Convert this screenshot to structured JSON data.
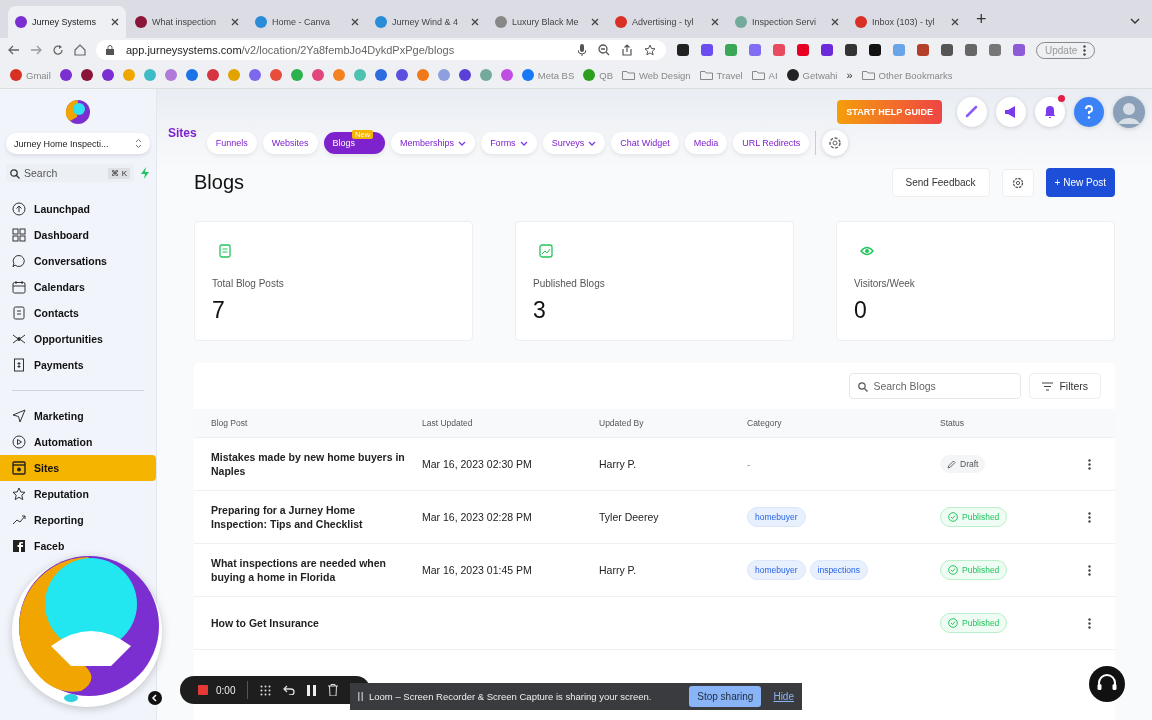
{
  "browser": {
    "tabs": [
      {
        "title": "Jurney Systems",
        "selected": true,
        "color": "#7b2fd0"
      },
      {
        "title": "What inspection",
        "selected": false,
        "color": "#8a1538"
      },
      {
        "title": "Home - Canva",
        "selected": false,
        "color": "#2a8bd8"
      },
      {
        "title": "Jurney Wind & 4",
        "selected": false,
        "color": "#2a8bd8"
      },
      {
        "title": "Luxury Black Me",
        "selected": false,
        "color": "#888888"
      },
      {
        "title": "Advertising - tyl",
        "selected": false,
        "color": "#d93025"
      },
      {
        "title": "Inspection Servi",
        "selected": false,
        "color": "#74aa9c"
      },
      {
        "title": "Inbox (103) - tyl",
        "selected": false,
        "color": "#d93025"
      }
    ],
    "new_tab": "+",
    "url": {
      "domain": "app.jurneysystems.com",
      "path": "/v2/location/2Ya8fembJo4DykdPxPge/blogs"
    },
    "extensions": [
      {
        "color": "#222222"
      },
      {
        "color": "#6a4cf0"
      },
      {
        "color": "#3aa757"
      },
      {
        "color": "#7f6df2"
      },
      {
        "color": "#e84a5f"
      },
      {
        "color": "#e60023"
      },
      {
        "color": "#6c2bd9"
      },
      {
        "color": "#333333"
      },
      {
        "color": "#111111"
      },
      {
        "color": "#6aa4e8"
      },
      {
        "color": "#b5402a"
      },
      {
        "color": "#555555"
      },
      {
        "color": "#666666"
      },
      {
        "color": "#777777"
      },
      {
        "color": "#8e5bd6"
      }
    ],
    "update_button": "Update",
    "bookmarks": [
      {
        "kind": "link",
        "label": "Gmail",
        "color": "#d93025"
      },
      {
        "kind": "icon",
        "color": "#7b2fd0"
      },
      {
        "kind": "icon",
        "color": "#8a1538"
      },
      {
        "kind": "icon",
        "color": "#7b2fd0"
      },
      {
        "kind": "icon",
        "color": "#f0a500"
      },
      {
        "kind": "icon",
        "color": "#3dbcc7"
      },
      {
        "kind": "icon",
        "color": "#b07ad8"
      },
      {
        "kind": "icon",
        "color": "#1b73e8"
      },
      {
        "kind": "icon",
        "color": "#d6343f"
      },
      {
        "kind": "icon",
        "color": "#e0a300"
      },
      {
        "kind": "icon",
        "color": "#7b68ee"
      },
      {
        "kind": "icon",
        "color": "#e84c3d"
      },
      {
        "kind": "icon",
        "color": "#2bb24c"
      },
      {
        "kind": "icon",
        "color": "#e0457b"
      },
      {
        "kind": "icon",
        "color": "#f48120"
      },
      {
        "kind": "icon",
        "color": "#4fc1b0"
      },
      {
        "kind": "icon",
        "color": "#2c6de0"
      },
      {
        "kind": "icon",
        "color": "#5b4fe0"
      },
      {
        "kind": "icon",
        "color": "#f07a1a"
      },
      {
        "kind": "icon",
        "color": "#8e9fe0"
      },
      {
        "kind": "icon",
        "color": "#5b3fd6"
      },
      {
        "kind": "icon",
        "color": "#74aa9c"
      },
      {
        "kind": "icon",
        "color": "#c04ee0"
      },
      {
        "kind": "link",
        "label": "Meta BS",
        "color": "#1877f2"
      },
      {
        "kind": "link",
        "label": "QB",
        "color": "#2ca01c"
      },
      {
        "kind": "folder",
        "label": "Web Design"
      },
      {
        "kind": "folder",
        "label": "Travel"
      },
      {
        "kind": "folder",
        "label": "AI"
      },
      {
        "kind": "link",
        "label": "Getwahi",
        "color": "#222222"
      },
      {
        "kind": "more",
        "label": "»"
      },
      {
        "kind": "folder",
        "label": "Other Bookmarks"
      }
    ]
  },
  "sidebar": {
    "account": "Jurney Home Inspecti...",
    "search": {
      "placeholder": "Search",
      "shortcut": "⌘ K"
    },
    "groups": [
      [
        {
          "label": "Launchpad",
          "selected": false
        },
        {
          "label": "Dashboard",
          "selected": false
        },
        {
          "label": "Conversations",
          "selected": false
        },
        {
          "label": "Calendars",
          "selected": false
        },
        {
          "label": "Contacts",
          "selected": false
        },
        {
          "label": "Opportunities",
          "selected": false
        },
        {
          "label": "Payments",
          "selected": false
        }
      ],
      [
        {
          "label": "Marketing",
          "selected": false
        },
        {
          "label": "Automation",
          "selected": false
        },
        {
          "label": "Sites",
          "selected": true
        },
        {
          "label": "Reputation",
          "selected": false
        },
        {
          "label": "Reporting",
          "selected": false
        },
        {
          "label": "Faceb",
          "selected": false
        }
      ]
    ]
  },
  "header": {
    "section": "Sites",
    "nav": [
      {
        "label": "Funnels",
        "selected": false,
        "dropdown": false
      },
      {
        "label": "Websites",
        "selected": false,
        "dropdown": false
      },
      {
        "label": "Blogs",
        "selected": true,
        "dropdown": false,
        "badge": "New"
      },
      {
        "label": "Memberships",
        "selected": false,
        "dropdown": true
      },
      {
        "label": "Forms",
        "selected": false,
        "dropdown": true
      },
      {
        "label": "Surveys",
        "selected": false,
        "dropdown": true
      },
      {
        "label": "Chat Widget",
        "selected": false,
        "dropdown": false
      },
      {
        "label": "Media",
        "selected": false,
        "dropdown": false
      },
      {
        "label": "URL Redirects",
        "selected": false,
        "dropdown": false
      }
    ],
    "help_guide": "START HELP GUIDE",
    "notification_dot": true
  },
  "page": {
    "title": "Blogs",
    "feedback_button": "Send Feedback",
    "new_button": "+ New Post",
    "stats": [
      {
        "label": "Total Blog Posts",
        "value": "7"
      },
      {
        "label": "Published Blogs",
        "value": "3"
      },
      {
        "label": "Visitors/Week",
        "value": "0"
      }
    ],
    "search": {
      "placeholder": "Search Blogs"
    },
    "filters_button": "Filters",
    "table": {
      "columns": [
        "Blog Post",
        "Last Updated",
        "Updated By",
        "Category",
        "Status"
      ],
      "rows": [
        {
          "title": "Mistakes made by new home buyers in Naples",
          "updated": "Mar 16, 2023 02:30 PM",
          "by": "Harry P.",
          "empty_category": "-",
          "categories": [],
          "status": "Draft",
          "kind": "draft"
        },
        {
          "title": "Preparing for a Jurney Home Inspection: Tips and Checklist",
          "updated": "Mar 16, 2023 02:28 PM",
          "by": "Tyler Deerey",
          "categories": [
            "homebuyer"
          ],
          "status": "Published",
          "kind": "published"
        },
        {
          "title": "What inspections are needed when buying a home in Florida",
          "updated": "Mar 16, 2023 01:45 PM",
          "by": "Harry P.",
          "categories": [
            "homebuyer",
            "inspections"
          ],
          "status": "Published",
          "kind": "published"
        },
        {
          "title": "How to Get Insurance",
          "categories": [],
          "status": "Published",
          "kind": "published"
        }
      ]
    }
  },
  "loom": {
    "timer": "0:00",
    "message": "Loom – Screen Recorder & Screen Capture is sharing your screen.",
    "stop_button": "Stop sharing",
    "hide_link": "Hide"
  }
}
